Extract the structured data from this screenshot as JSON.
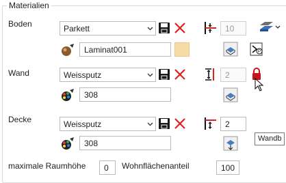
{
  "group_title": "Materialien",
  "rows": {
    "boden": {
      "label": "Boden",
      "material": "Parkett",
      "texture": "Laminat001",
      "height_value": "10"
    },
    "wand": {
      "label": "Wand",
      "material": "Weissputz",
      "color_code": "308",
      "height_value": "2"
    },
    "decke": {
      "label": "Decke",
      "material": "Weissputz",
      "color_code": "308",
      "height_value": "2"
    }
  },
  "bottom": {
    "max_height_label": "maximale Raumhöhe",
    "max_height_value": "0",
    "wohnflaeche_label": "Wohnflächenanteil",
    "wohnflaeche_value": "100"
  },
  "tooltip": "Wandb",
  "colors": {
    "swatch": "#f7dba7",
    "save_icon": "#1a1a1a",
    "delete_icon": "#e02020",
    "lock_icon": "#c4161c"
  }
}
